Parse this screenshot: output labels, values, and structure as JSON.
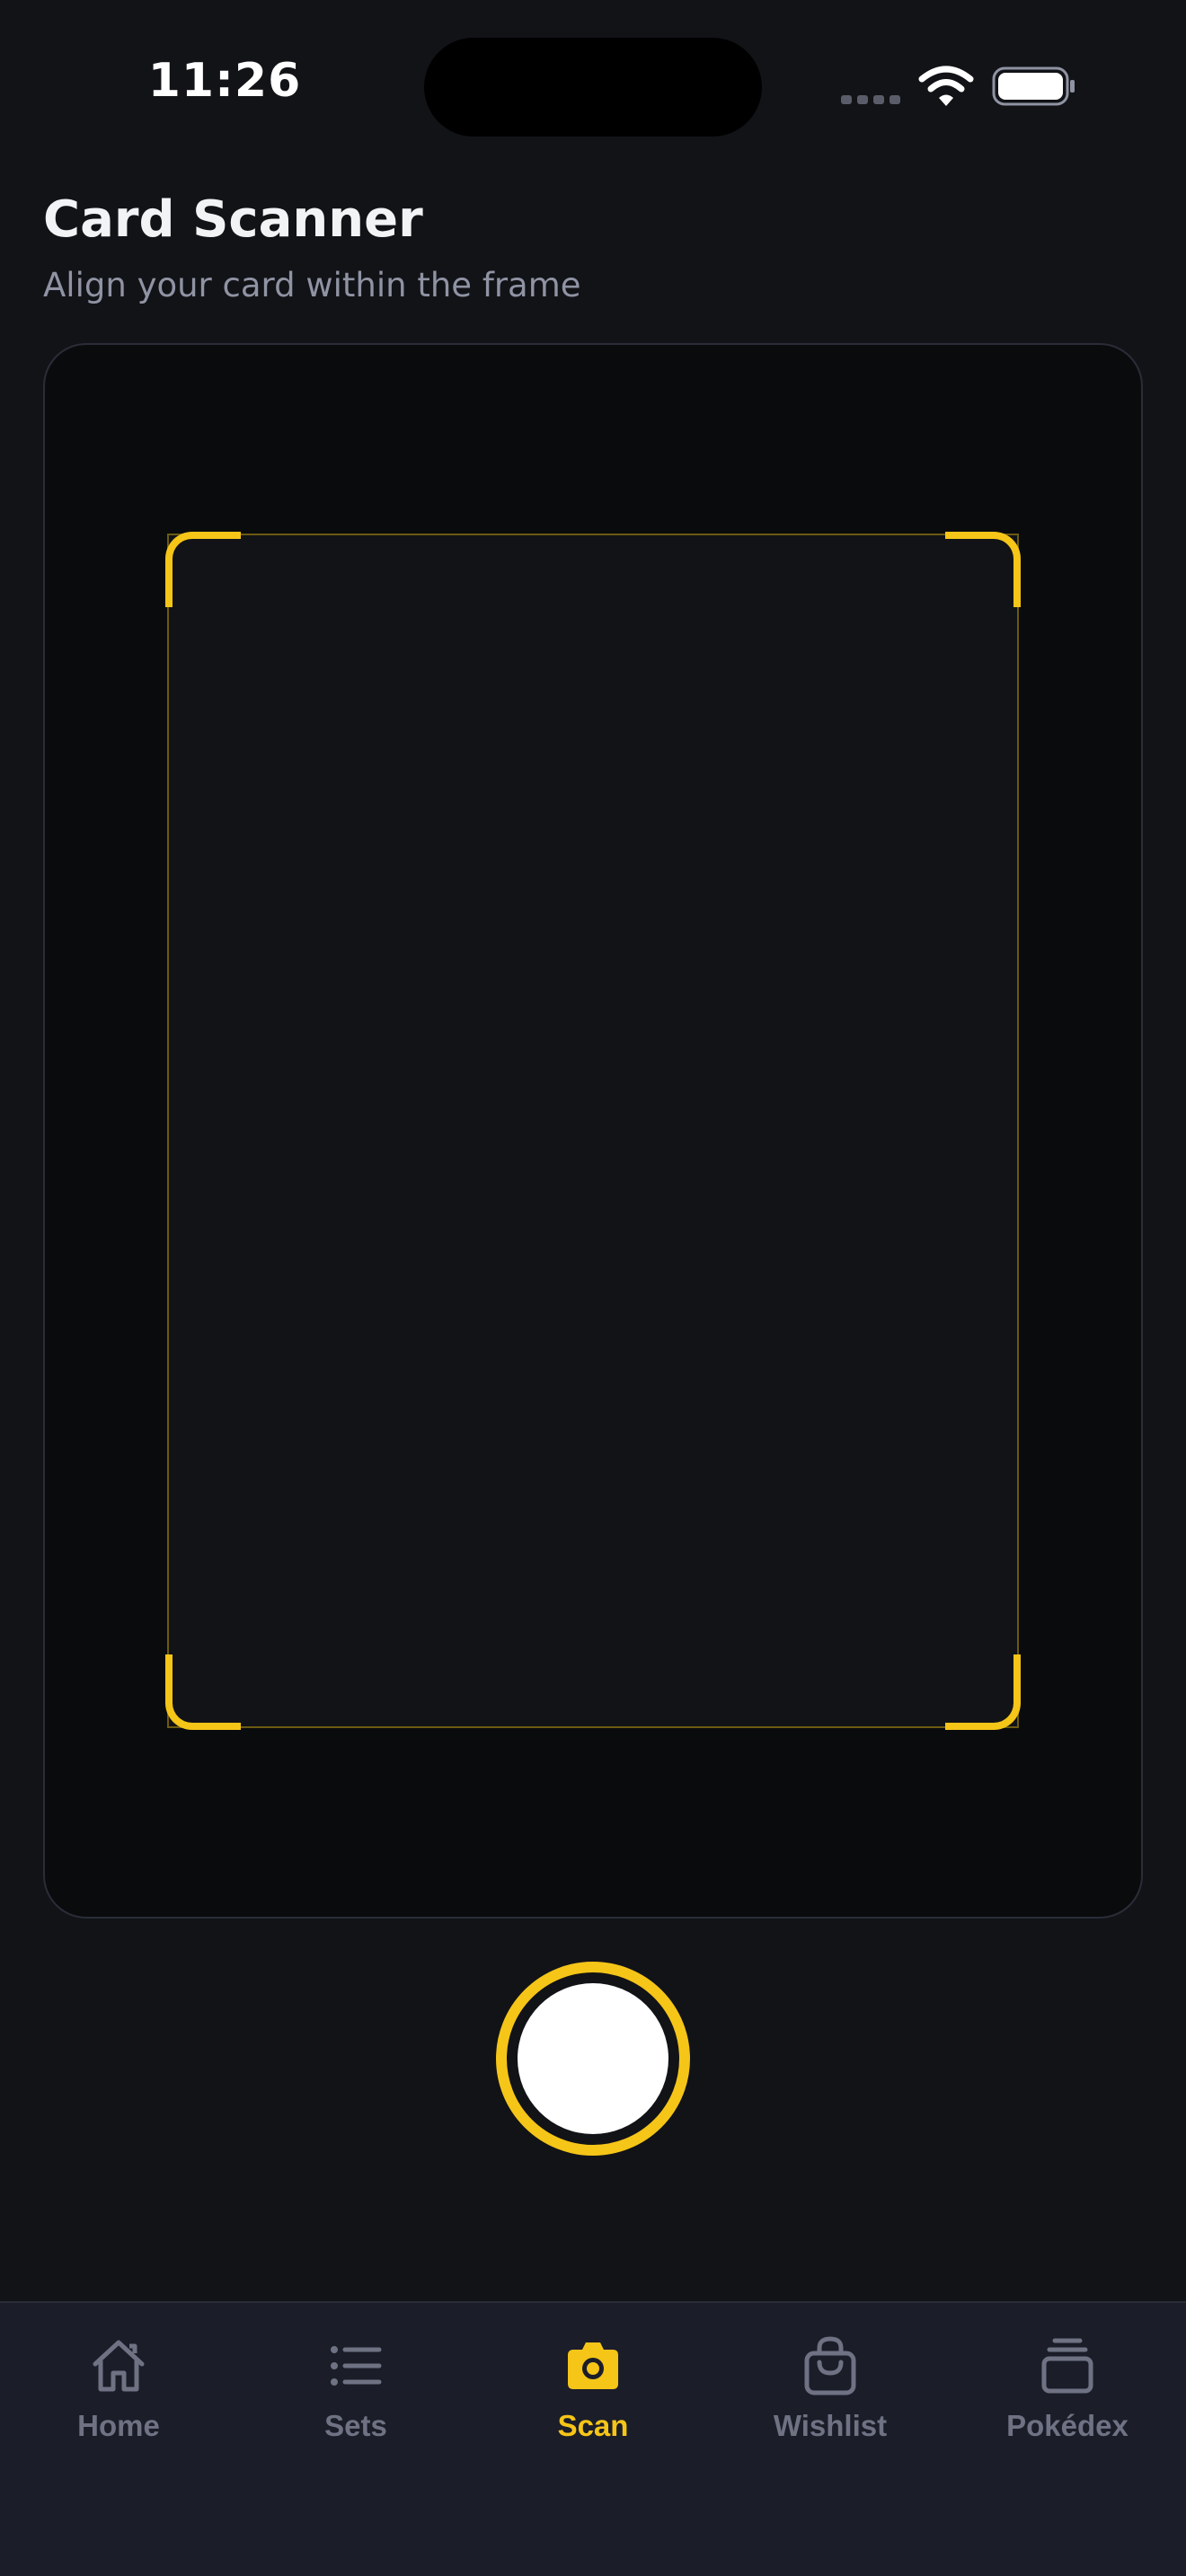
{
  "status_bar": {
    "time": "11:26"
  },
  "header": {
    "title": "Card Scanner",
    "subtitle": "Align your card within the frame"
  },
  "colors": {
    "accent": "#f5c518",
    "background": "#121317",
    "viewport": "#0a0b0d",
    "tab_bar": "#1b1d29",
    "inactive": "#6e7283"
  },
  "tabs": [
    {
      "label": "Home",
      "icon": "home-icon",
      "active": false
    },
    {
      "label": "Sets",
      "icon": "list-icon",
      "active": false
    },
    {
      "label": "Scan",
      "icon": "camera-icon",
      "active": true
    },
    {
      "label": "Wishlist",
      "icon": "shopping-bag-icon",
      "active": false
    },
    {
      "label": "Pokédex",
      "icon": "stacked-cards-icon",
      "active": false
    }
  ]
}
